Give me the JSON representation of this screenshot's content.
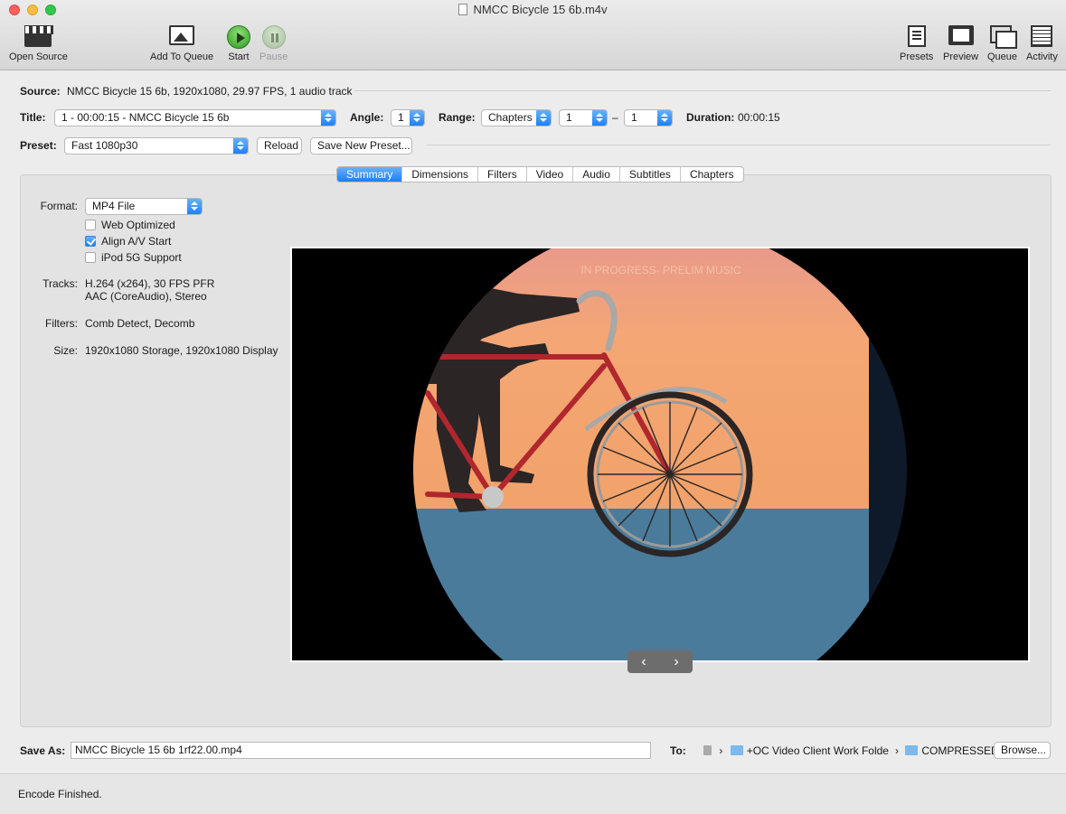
{
  "window": {
    "title": "NMCC Bicycle 15  6b.m4v"
  },
  "toolbar": {
    "open_source": "Open Source",
    "add_to_queue": "Add To Queue",
    "start": "Start",
    "pause": "Pause",
    "presets": "Presets",
    "preview": "Preview",
    "queue": "Queue",
    "activity": "Activity"
  },
  "source": {
    "label": "Source:",
    "value": "NMCC Bicycle 15  6b, 1920x1080, 29.97 FPS, 1 audio track"
  },
  "title_row": {
    "title_label": "Title:",
    "title_value": "1 - 00:00:15 - NMCC Bicycle 15  6b",
    "angle_label": "Angle:",
    "angle_value": "1",
    "range_label": "Range:",
    "range_type": "Chapters",
    "range_start": "1",
    "range_dash": "–",
    "range_end": "1",
    "duration_label": "Duration:",
    "duration_value": "00:00:15"
  },
  "preset_row": {
    "label": "Preset:",
    "value": "Fast 1080p30",
    "reload": "Reload",
    "save_new": "Save New Preset..."
  },
  "tabs": [
    {
      "label": "Summary",
      "active": true
    },
    {
      "label": "Dimensions"
    },
    {
      "label": "Filters"
    },
    {
      "label": "Video"
    },
    {
      "label": "Audio"
    },
    {
      "label": "Subtitles"
    },
    {
      "label": "Chapters"
    }
  ],
  "summary": {
    "format_label": "Format:",
    "format_value": "MP4 File",
    "web_optimized": {
      "label": "Web Optimized",
      "checked": false
    },
    "align_av": {
      "label": "Align A/V Start",
      "checked": true
    },
    "ipod": {
      "label": "iPod 5G Support",
      "checked": false
    },
    "tracks_label": "Tracks:",
    "tracks_line1": "H.264 (x264), 30 FPS PFR",
    "tracks_line2": "AAC (CoreAudio), Stereo",
    "filters_label": "Filters:",
    "filters_value": "Comb Detect, Decomb",
    "size_label": "Size:",
    "size_value": "1920x1080 Storage, 1920x1080 Display"
  },
  "preview": {
    "watermark": "IN PROGRESS- PRELIM MUSIC",
    "prev_arrow": "‹",
    "next_arrow": "›"
  },
  "save": {
    "label": "Save As:",
    "filename": "NMCC Bicycle 15  6b 1rf22.00.mp4",
    "to_label": "To:",
    "path_sep": "›",
    "folder1": "+OC Video Client Work Folder",
    "folder2": "COMPRESSED",
    "browse": "Browse..."
  },
  "status": {
    "text": "Encode Finished."
  },
  "colors": {
    "accent": "#1a7ef7",
    "sky": "#f3a66f",
    "ground": "#4d7d9c",
    "frame": "#b0272e"
  }
}
